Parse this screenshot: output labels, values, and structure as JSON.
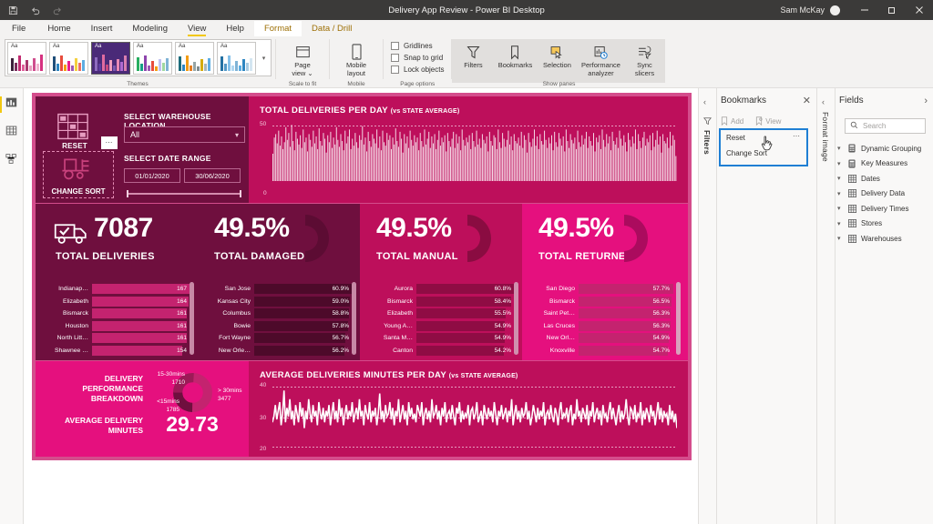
{
  "titlebar": {
    "doc_title": "Delivery App Review - Power BI Desktop",
    "user": "Sam McKay",
    "save_icon": "save-icon",
    "undo_icon": "undo-icon",
    "redo_icon": "redo-icon",
    "minimize": "─",
    "maximize": "❐",
    "close": "✕"
  },
  "menu": {
    "items": [
      {
        "label": "File"
      },
      {
        "label": "Home"
      },
      {
        "label": "Insert"
      },
      {
        "label": "Modeling"
      },
      {
        "label": "View"
      },
      {
        "label": "Help"
      },
      {
        "label": "Format"
      },
      {
        "label": "Data / Drill"
      }
    ]
  },
  "ribbon": {
    "themes_group": "Themes",
    "scale_group": "Scale to fit",
    "mobile_group": "Mobile",
    "page_options_group": "Page options",
    "show_panes_group": "Show panes",
    "page_view": "Page\nview ⌄",
    "page_view_line1": "Page",
    "page_view_line2": "view ⌄",
    "mobile_layout_line1": "Mobile",
    "mobile_layout_line2": "layout",
    "checkboxes": [
      {
        "label": "Gridlines",
        "checked": false
      },
      {
        "label": "Snap to grid",
        "checked": false
      },
      {
        "label": "Lock objects",
        "checked": false
      }
    ],
    "panes": [
      {
        "label": "Filters",
        "icon": "filter-icon"
      },
      {
        "label": "Bookmarks",
        "icon": "bookmark-icon"
      },
      {
        "label": "Selection",
        "icon": "selection-icon"
      },
      {
        "label": "Performance analyzer",
        "l1": "Performance",
        "l2": "analyzer",
        "icon": "performance-icon"
      },
      {
        "label": "Sync slicers",
        "l1": "Sync",
        "l2": "slicers",
        "icon": "sync-slicers-icon"
      }
    ],
    "theme_swatches": [
      {
        "name": "theme-default",
        "selected": false,
        "colors": [
          "#3b1f3a",
          "#7a2a5c",
          "#c22a70",
          "#e0609b",
          "#a8386e",
          "#e8a0c0",
          "#cf4e8e",
          "#f0b5d0",
          "#d6317f"
        ]
      },
      {
        "name": "theme-blue",
        "selected": false,
        "colors": [
          "#1f4e79",
          "#2e86c1",
          "#e74c3c",
          "#f39c12",
          "#e91e8c",
          "#9b59b6",
          "#f4d03f",
          "#ec7063",
          "#f5b7b1"
        ]
      },
      {
        "name": "theme-purple-dark",
        "selected": true,
        "colors": [
          "#8e6bbf",
          "#5b3a9e",
          "#e06ba0",
          "#c94a7e",
          "#f0a0c0",
          "#7a58b0",
          "#e88ab5",
          "#b06ad0",
          "#d97fb0"
        ]
      },
      {
        "name": "theme-green",
        "selected": false,
        "colors": [
          "#27ae60",
          "#16a085",
          "#8e44ad",
          "#9b59b6",
          "#e74c3c",
          "#f39c12",
          "#c0c0f0",
          "#a0d8a0",
          "#7fb3d5"
        ]
      },
      {
        "name": "theme-teal",
        "selected": false,
        "colors": [
          "#1b6b7a",
          "#2e86c1",
          "#f39c12",
          "#e67e22",
          "#95a5a6",
          "#7f8c8d",
          "#d4ac0d",
          "#aab7b8",
          "#5dade2"
        ]
      },
      {
        "name": "theme-steel",
        "selected": false,
        "colors": [
          "#2471a3",
          "#5499c7",
          "#85c1e9",
          "#aed6f1",
          "#7fb3d5",
          "#5dade2",
          "#2e86c1",
          "#a9cce3",
          "#d4e6f1"
        ]
      }
    ]
  },
  "leftrail": {
    "items": [
      {
        "name": "report-view",
        "icon": "report-icon",
        "active": true
      },
      {
        "name": "data-view",
        "icon": "table-icon",
        "active": false
      },
      {
        "name": "model-view",
        "icon": "model-icon",
        "active": false
      }
    ]
  },
  "report": {
    "slicer": {
      "reset_label": "RESET",
      "change_sort_label": "CHANGE SORT",
      "warehouse_title": "SELECT WAREHOUSE LOCATION",
      "warehouse_value": "All",
      "date_title": "SELECT DATE RANGE",
      "date_start": "01/01/2020",
      "date_end": "30/06/2020",
      "warehouse_icon": "warehouse-shelf-icon",
      "forklift_icon": "forklift-icon"
    },
    "deliveries_chart": {
      "title": "TOTAL DELIVERIES PER DAY",
      "subtitle": "(vs STATE AVERAGE)"
    },
    "avg_chart": {
      "title": "AVERAGE DELIVERIES MINUTES PER DAY",
      "subtitle": "(vs STATE AVERAGE)"
    },
    "kpis": [
      {
        "name": "total-deliveries",
        "value": "7087",
        "label": "TOTAL DELIVERIES",
        "icon": "delivery-truck-icon",
        "has_arc": false,
        "list": [
          {
            "name": "Indianap…",
            "value": "167",
            "pct": 100
          },
          {
            "name": "Elizabeth",
            "value": "164",
            "pct": 98
          },
          {
            "name": "Bismarck",
            "value": "161",
            "pct": 96
          },
          {
            "name": "Houston",
            "value": "161",
            "pct": 96
          },
          {
            "name": "North Litt…",
            "value": "161",
            "pct": 96
          },
          {
            "name": "Shawnee …",
            "value": "154",
            "pct": 92
          }
        ]
      },
      {
        "name": "total-damaged",
        "value": "49.5%",
        "label": "TOTAL DAMAGED",
        "has_arc": true,
        "list": [
          {
            "name": "San Jose",
            "value": "60.9%",
            "pct": 100
          },
          {
            "name": "Kansas City",
            "value": "59.0%",
            "pct": 97
          },
          {
            "name": "Columbus",
            "value": "58.8%",
            "pct": 96
          },
          {
            "name": "Bowie",
            "value": "57.8%",
            "pct": 95
          },
          {
            "name": "Fort Wayne",
            "value": "56.7%",
            "pct": 93
          },
          {
            "name": "New Orle…",
            "value": "56.2%",
            "pct": 92
          }
        ]
      },
      {
        "name": "total-manual",
        "value": "49.5%",
        "label": "TOTAL MANUAL",
        "has_arc": true,
        "list": [
          {
            "name": "Aurora",
            "value": "60.8%",
            "pct": 100
          },
          {
            "name": "Bismarck",
            "value": "58.4%",
            "pct": 96
          },
          {
            "name": "Elizabeth",
            "value": "55.5%",
            "pct": 91
          },
          {
            "name": "Young A…",
            "value": "54.9%",
            "pct": 90
          },
          {
            "name": "Santa M…",
            "value": "54.9%",
            "pct": 90
          },
          {
            "name": "Canton",
            "value": "54.2%",
            "pct": 89
          }
        ]
      },
      {
        "name": "total-returned",
        "value": "49.5%",
        "label": "TOTAL RETURNED",
        "has_arc": true,
        "list": [
          {
            "name": "San Diego",
            "value": "57.7%",
            "pct": 100
          },
          {
            "name": "Bismarck",
            "value": "56.5%",
            "pct": 98
          },
          {
            "name": "Saint Pet…",
            "value": "56.3%",
            "pct": 97
          },
          {
            "name": "Las Cruces",
            "value": "56.3%",
            "pct": 97
          },
          {
            "name": "New Orl…",
            "value": "54.9%",
            "pct": 95
          },
          {
            "name": "Knoxville",
            "value": "54.7%",
            "pct": 94
          }
        ]
      }
    ],
    "performance": {
      "title_l1": "DELIVERY PERFORMANCE",
      "title_l2": "BREAKDOWN",
      "avg_l1": "AVERAGE DELIVERY",
      "avg_l2": "MINUTES",
      "avg_value": "29.73",
      "segments": [
        {
          "label": "15-30mins",
          "value": "1710"
        },
        {
          "label": "> 30mins",
          "value": "3477"
        },
        {
          "label": "<15mins",
          "value": "1785"
        }
      ]
    }
  },
  "chart_data": [
    {
      "type": "bar",
      "title": "TOTAL DELIVERIES PER DAY (vs STATE AVERAGE)",
      "xlabel": "",
      "ylabel": "",
      "ylim": [
        0,
        50
      ],
      "ytick_labels": [
        "0",
        "50"
      ],
      "grid": true,
      "categories": [],
      "values": [
        24,
        38,
        41,
        33,
        44,
        31,
        39,
        28,
        34,
        47,
        36,
        42,
        30,
        49,
        35,
        27,
        43,
        37,
        32,
        40,
        29,
        45,
        34,
        38,
        26,
        41,
        36,
        30,
        44,
        33,
        39,
        28,
        46,
        35,
        31,
        42,
        37,
        25,
        40,
        34,
        43,
        29,
        38,
        32,
        47,
        36,
        30,
        41,
        35,
        27,
        44,
        33,
        39,
        45,
        28,
        37,
        31,
        42,
        34,
        29,
        40,
        36,
        48,
        32,
        38,
        26,
        43,
        35,
        30,
        41,
        37,
        33,
        45,
        29,
        39,
        27,
        44,
        34,
        31,
        42,
        36,
        40,
        28,
        38,
        32,
        46,
        35,
        30,
        43,
        37,
        25,
        41,
        33,
        39,
        29,
        44,
        36,
        31,
        40,
        34,
        38,
        27,
        42,
        35,
        30,
        45,
        32,
        37,
        43,
        29,
        39,
        33,
        41,
        28,
        36,
        44,
        31,
        38,
        34,
        40,
        26,
        42,
        35,
        30,
        37,
        43,
        29,
        41,
        33,
        39,
        27,
        45,
        36,
        31,
        38,
        34,
        40,
        28,
        42,
        35,
        30,
        44,
        32,
        37,
        29,
        41,
        36,
        33,
        39,
        26,
        43,
        35,
        31,
        40,
        38,
        28,
        45,
        34,
        29,
        42,
        37,
        30,
        36,
        44,
        32,
        39,
        27,
        41,
        35,
        33,
        38,
        31,
        43,
        29,
        40,
        36,
        25,
        42,
        34,
        30,
        37,
        45,
        31,
        39,
        28,
        41,
        35,
        32,
        44,
        36,
        29,
        38,
        33,
        40,
        27,
        43,
        34,
        30,
        42,
        37,
        31,
        39,
        26,
        45,
        35,
        29,
        41,
        36,
        33,
        38,
        28,
        44,
        34,
        30,
        40,
        32,
        37,
        43,
        29,
        39,
        35,
        31,
        42,
        26,
        38,
        34,
        40,
        28,
        45,
        36,
        30,
        41,
        33,
        39,
        27,
        43,
        35,
        32,
        38,
        29,
        44,
        37,
        31,
        40,
        34,
        26,
        42,
        36,
        30,
        39,
        33,
        45,
        28,
        41,
        35,
        29,
        38,
        43,
        31,
        37,
        34,
        40,
        27,
        42,
        30,
        36,
        44,
        32,
        39,
        25,
        41,
        35,
        33,
        38,
        29,
        43,
        31,
        40,
        36,
        22
      ]
    },
    {
      "type": "line",
      "title": "AVERAGE DELIVERIES MINUTES PER DAY (vs STATE AVERAGE)",
      "xlabel": "",
      "ylabel": "",
      "ylim": [
        20,
        40
      ],
      "ytick_labels": [
        "20",
        "30",
        "40"
      ],
      "grid": true,
      "values": [
        27,
        29,
        33,
        28,
        31,
        34,
        26,
        30,
        38,
        27,
        32,
        29,
        35,
        28,
        31,
        26,
        33,
        30,
        27,
        34,
        29,
        32,
        25,
        31,
        28,
        35,
        30,
        27,
        33,
        29,
        31,
        26,
        34,
        30,
        28,
        32,
        27,
        31,
        29,
        33,
        26,
        30,
        34,
        28,
        31,
        27,
        35,
        29,
        32,
        26,
        30,
        33,
        28,
        31,
        29,
        34,
        27,
        30,
        32,
        28,
        35,
        29,
        31,
        26,
        33,
        30,
        28,
        34,
        27,
        31,
        29,
        32,
        26,
        30,
        37,
        28,
        31,
        27,
        33,
        29,
        30,
        34,
        28,
        32,
        26,
        31,
        29,
        35,
        27,
        30,
        33,
        28,
        31,
        26,
        34,
        29,
        32,
        28,
        30,
        27,
        33,
        31,
        29,
        34,
        26,
        30,
        32,
        28,
        31,
        27,
        35,
        29,
        30,
        33,
        28,
        31,
        26,
        32,
        29,
        34,
        27,
        30,
        31,
        28,
        33,
        29,
        26,
        32,
        30,
        34,
        27,
        31,
        28,
        30,
        29,
        33,
        26,
        31,
        32,
        28,
        30,
        34,
        27,
        29,
        31,
        26,
        33,
        30,
        28,
        32,
        29,
        31,
        27,
        34,
        30,
        26,
        31,
        29,
        33,
        28,
        30,
        32,
        27,
        31,
        29,
        35,
        26,
        30,
        33,
        28,
        31,
        27,
        32,
        29,
        30,
        34,
        28,
        31,
        26,
        29,
        33,
        30,
        27,
        32,
        28,
        31,
        29,
        34,
        26,
        30,
        31,
        28,
        33,
        29,
        27,
        32,
        30,
        26,
        31,
        34,
        28,
        30,
        29,
        32,
        27,
        31,
        33,
        26,
        30,
        28,
        35,
        29,
        31,
        27,
        32,
        30,
        28,
        33,
        26,
        31,
        29,
        34,
        27,
        30,
        32,
        28,
        31,
        26,
        33,
        29,
        30,
        27,
        31,
        34,
        28,
        32,
        29,
        26,
        30,
        33,
        27,
        31,
        28,
        30,
        35,
        29,
        26,
        32,
        31,
        28,
        33,
        27,
        30,
        29,
        34,
        26,
        31,
        28,
        32,
        30,
        27,
        33,
        29,
        31,
        26,
        30,
        34,
        28,
        32,
        27,
        31,
        29,
        30,
        26,
        33,
        28,
        31,
        27,
        30,
        25
      ]
    },
    {
      "type": "pie",
      "title": "DELIVERY PERFORMANCE BREAKDOWN",
      "labels": [
        "15-30mins",
        "> 30mins",
        "<15mins"
      ],
      "values": [
        1710,
        3477,
        1785
      ],
      "colors": [
        "#6f0f3e",
        "#c4236f",
        "#9c1a57"
      ]
    }
  ],
  "bookmarks_pane": {
    "collapse_icon": "chevron-left-icon",
    "filters_label": "Filters",
    "filter_icon": "filter-icon",
    "title": "Bookmarks",
    "close_icon": "close-icon",
    "add_label": "Add",
    "view_label": "View",
    "add_icon": "add-bookmark-icon",
    "view_icon": "view-bookmark-icon",
    "items": [
      {
        "label": "Reset",
        "has_ellipsis": true
      },
      {
        "label": "Change Sort",
        "has_ellipsis": false
      }
    ]
  },
  "fields_pane": {
    "collapse_icon": "chevron-left-icon",
    "format_image_label": "Format image",
    "title": "Fields",
    "expand_icon": "chevron-right-icon",
    "search_placeholder": "Search",
    "search_icon": "search-icon",
    "items": [
      {
        "label": "Dynamic Grouping",
        "icon": "measure-icon"
      },
      {
        "label": "Key Measures",
        "icon": "measure-icon"
      },
      {
        "label": "Dates",
        "icon": "table-icon"
      },
      {
        "label": "Delivery Data",
        "icon": "table-icon"
      },
      {
        "label": "Delivery Times",
        "icon": "table-icon"
      },
      {
        "label": "Stores",
        "icon": "table-icon"
      },
      {
        "label": "Warehouses",
        "icon": "table-icon"
      }
    ]
  },
  "colors": {
    "accent_yellow": "#f2c811",
    "brand_magenta": "#e5107e",
    "deep_magenta": "#bd0f5b",
    "dark_plum": "#6f0f3e",
    "canvas_border": "#d44d8c",
    "highlight_blue": "#1f7fd4"
  }
}
